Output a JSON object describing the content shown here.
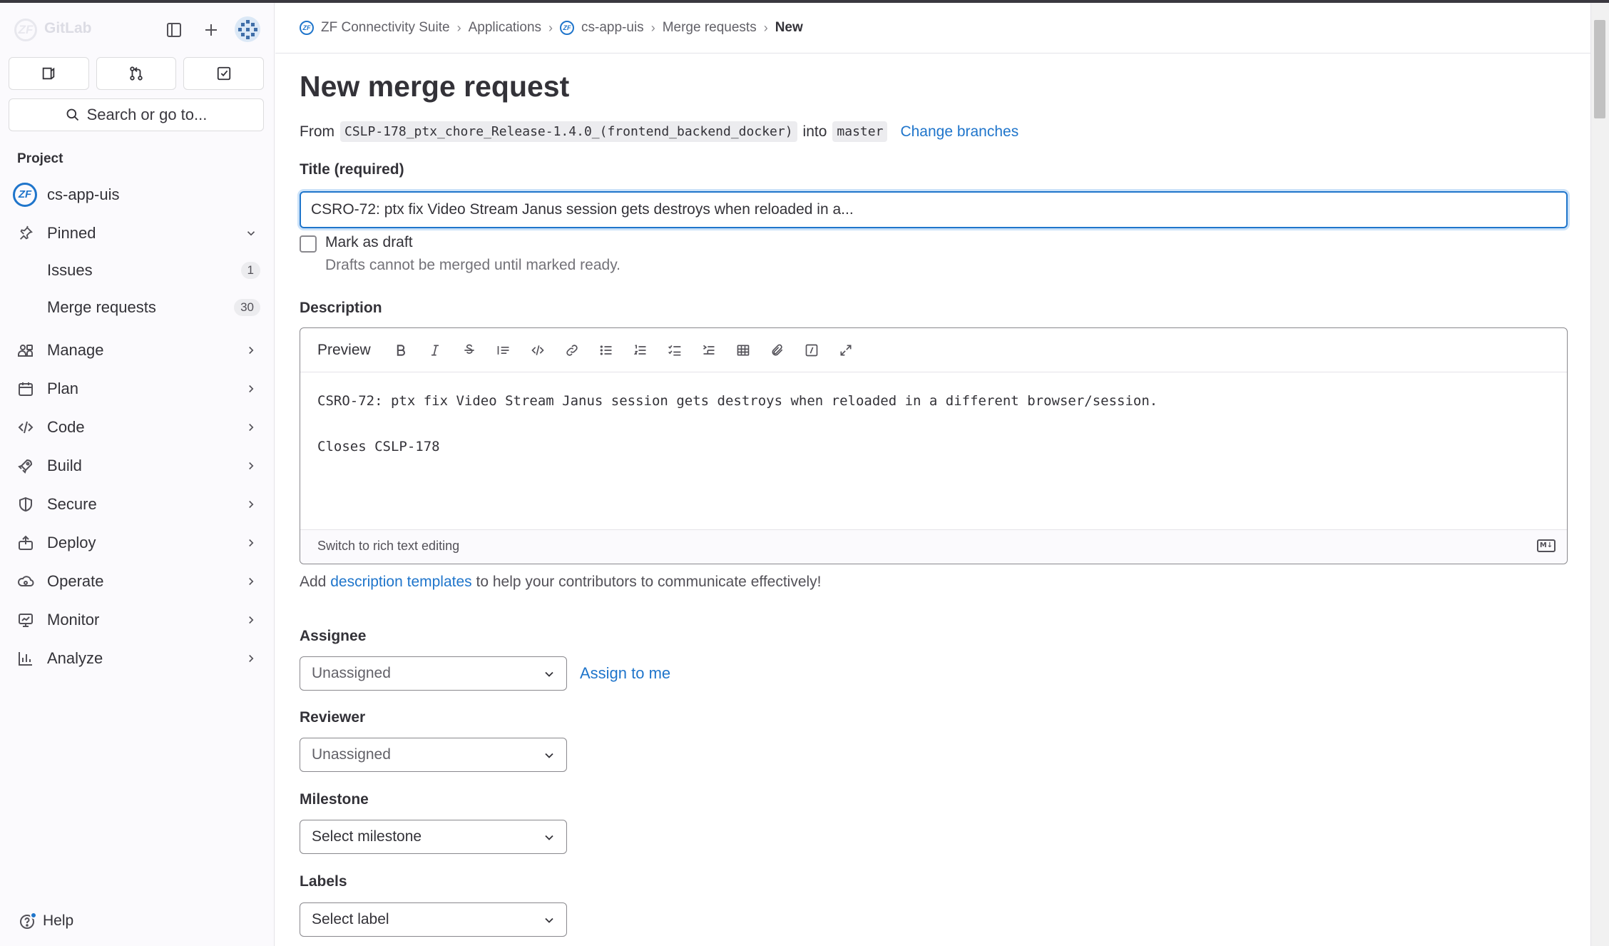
{
  "app": {
    "name": "GitLab"
  },
  "sidebar": {
    "search_label": "Search or go to...",
    "section_title": "Project",
    "project_name": "cs-app-uis",
    "pinned_label": "Pinned",
    "pinned_items": [
      {
        "label": "Issues",
        "count": "1"
      },
      {
        "label": "Merge requests",
        "count": "30"
      }
    ],
    "nav_items": [
      {
        "label": "Manage",
        "icon": "users-icon"
      },
      {
        "label": "Plan",
        "icon": "calendar-icon"
      },
      {
        "label": "Code",
        "icon": "code-icon"
      },
      {
        "label": "Build",
        "icon": "rocket-icon"
      },
      {
        "label": "Secure",
        "icon": "shield-icon"
      },
      {
        "label": "Deploy",
        "icon": "deploy-icon"
      },
      {
        "label": "Operate",
        "icon": "cloud-icon"
      },
      {
        "label": "Monitor",
        "icon": "monitor-icon"
      },
      {
        "label": "Analyze",
        "icon": "chart-icon"
      }
    ],
    "help_label": "Help"
  },
  "breadcrumb": [
    "ZF Connectivity Suite",
    "Applications",
    "cs-app-uis",
    "Merge requests",
    "New"
  ],
  "page": {
    "title": "New merge request",
    "from_label": "From",
    "source_branch": "CSLP-178_ptx_chore_Release-1.4.0_(frontend_backend_docker)",
    "into_label": "into",
    "target_branch": "master",
    "change_branches": "Change branches"
  },
  "form": {
    "title_label": "Title (required)",
    "title_value": "CSRO-72: ptx fix Video Stream Janus session gets destroys when reloaded in a...",
    "draft_label": "Mark as draft",
    "draft_help": "Drafts cannot be merged until marked ready.",
    "description_label": "Description",
    "preview_tab": "Preview",
    "description_line1": "CSRO-72: ptx fix Video Stream Janus session gets destroys when reloaded in a different browser/session.",
    "description_line2": "Closes CSLP-178",
    "switch_rich": "Switch to rich text editing",
    "md_badge": "M↓",
    "desc_help_prefix": "Add",
    "desc_help_link": "description templates",
    "desc_help_suffix": "to help your contributors to communicate effectively!",
    "assignee_label": "Assignee",
    "assignee_value": "Unassigned",
    "assign_to_me": "Assign to me",
    "reviewer_label": "Reviewer",
    "reviewer_value": "Unassigned",
    "milestone_label": "Milestone",
    "milestone_value": "Select milestone",
    "labels_label": "Labels",
    "labels_value": "Select label"
  },
  "colors": {
    "accent": "#1f75cb",
    "text": "#333238",
    "sidebar_bg": "#fbfafd"
  }
}
